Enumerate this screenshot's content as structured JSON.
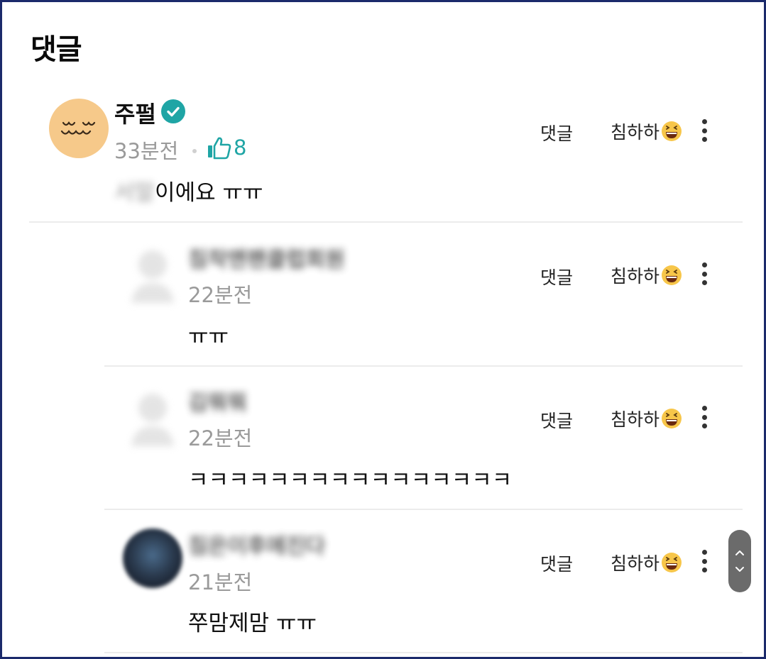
{
  "header": {
    "title": "댓글"
  },
  "actions": {
    "reply_label": "댓글",
    "react_label": "침하하"
  },
  "colors": {
    "accent": "#1fa5a5",
    "avatar_main": "#f6c98a",
    "border": "#1b2a6b"
  },
  "comments": [
    {
      "author": "주펄",
      "verified": true,
      "time": "33분전",
      "likes": "8",
      "text_blurred": "서말",
      "text": "이에요 ㅠㅠ"
    },
    {
      "author": "침착맨팬클럽회원",
      "time": "22분전",
      "text": "ㅠㅠ"
    },
    {
      "author": "김뭐뭐",
      "time": "22분전",
      "text": "ㅋㅋㅋㅋㅋㅋㅋㅋㅋㅋㅋㅋㅋㅋㅋㅋ"
    },
    {
      "author": "침은이후에진다",
      "time": "21분전",
      "text": "쭈맘제맘 ㅠㅠ"
    }
  ]
}
